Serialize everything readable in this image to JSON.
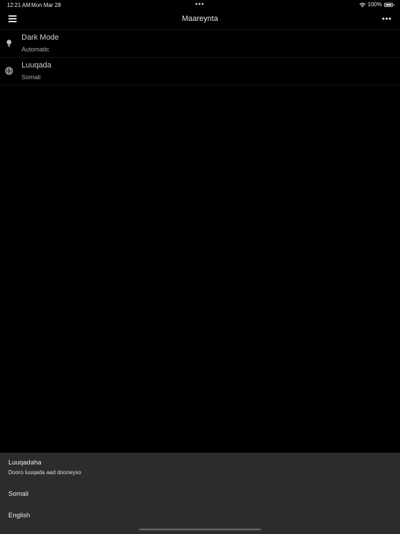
{
  "status_bar": {
    "time": "12:21 AM",
    "date": "Mon Mar 28",
    "dots": "•••",
    "battery": "100%",
    "icons": [
      "wifi-icon",
      "battery-icon"
    ]
  },
  "nav": {
    "title": "Maareynta",
    "left_icon": "menu-icon",
    "right_icon": "more-icon",
    "more_glyph": "•••"
  },
  "settings": [
    {
      "icon": "lightbulb-icon",
      "title": "Dark Mode",
      "value": "Automatic"
    },
    {
      "icon": "globe-icon",
      "title": "Luuqada",
      "value": "Somali"
    }
  ],
  "sheet": {
    "title": "Luuqadaha",
    "subtitle": "Dooro luuqada aad dooneyso",
    "options": [
      "Somali",
      "English"
    ]
  },
  "colors": {
    "background": "#000000",
    "sheet": "#2c2c2e",
    "text_primary": "#d0d0d0",
    "text_secondary": "#a9a9a9"
  }
}
